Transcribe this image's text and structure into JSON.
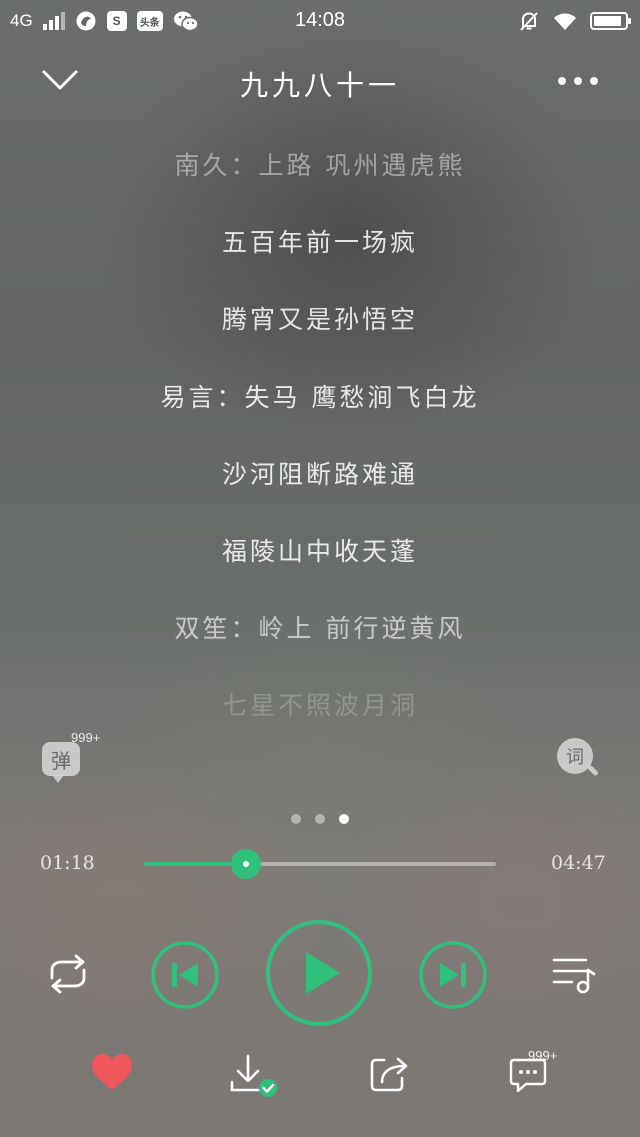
{
  "status_bar": {
    "network": "4G",
    "time": "14:08",
    "sogou_icon_label": "S",
    "toutiao_icon_label": "头条",
    "battery_level": 0.9,
    "icons": [
      "signal-icon",
      "browser-icon",
      "sogou-icon",
      "toutiao-icon",
      "wechat-icon",
      "mute-icon",
      "wifi-icon",
      "battery-icon"
    ]
  },
  "header": {
    "title": "九九八十一",
    "back_icon": "chevron-down-icon",
    "more_icon": "more-dots-icon"
  },
  "lyrics": [
    "南久：上路 巩州遇虎熊",
    "五百年前一场疯",
    "腾宵又是孙悟空",
    "易言：失马 鹰愁涧飞白龙",
    "沙河阻断路难通",
    "福陵山中收天蓬",
    "双笙：岭上 前行逆黄风",
    "七星不照波月洞"
  ],
  "danmaku": {
    "label": "弹",
    "count": "999+"
  },
  "lyric_button": {
    "label": "词"
  },
  "pager": {
    "total": 3,
    "active_index": 2
  },
  "player": {
    "elapsed": "01:18",
    "total": "04:47",
    "progress": 0.29,
    "state": "paused",
    "accent_color": "#2fc07a"
  },
  "controls": [
    "repeat-icon",
    "previous-icon",
    "play-icon",
    "next-icon",
    "playlist-icon"
  ],
  "bottom_bar": {
    "icons": [
      "heart-icon",
      "download-icon",
      "share-icon",
      "comment-icon"
    ],
    "favorite_color": "#f0575b",
    "comment_count": "999+"
  }
}
